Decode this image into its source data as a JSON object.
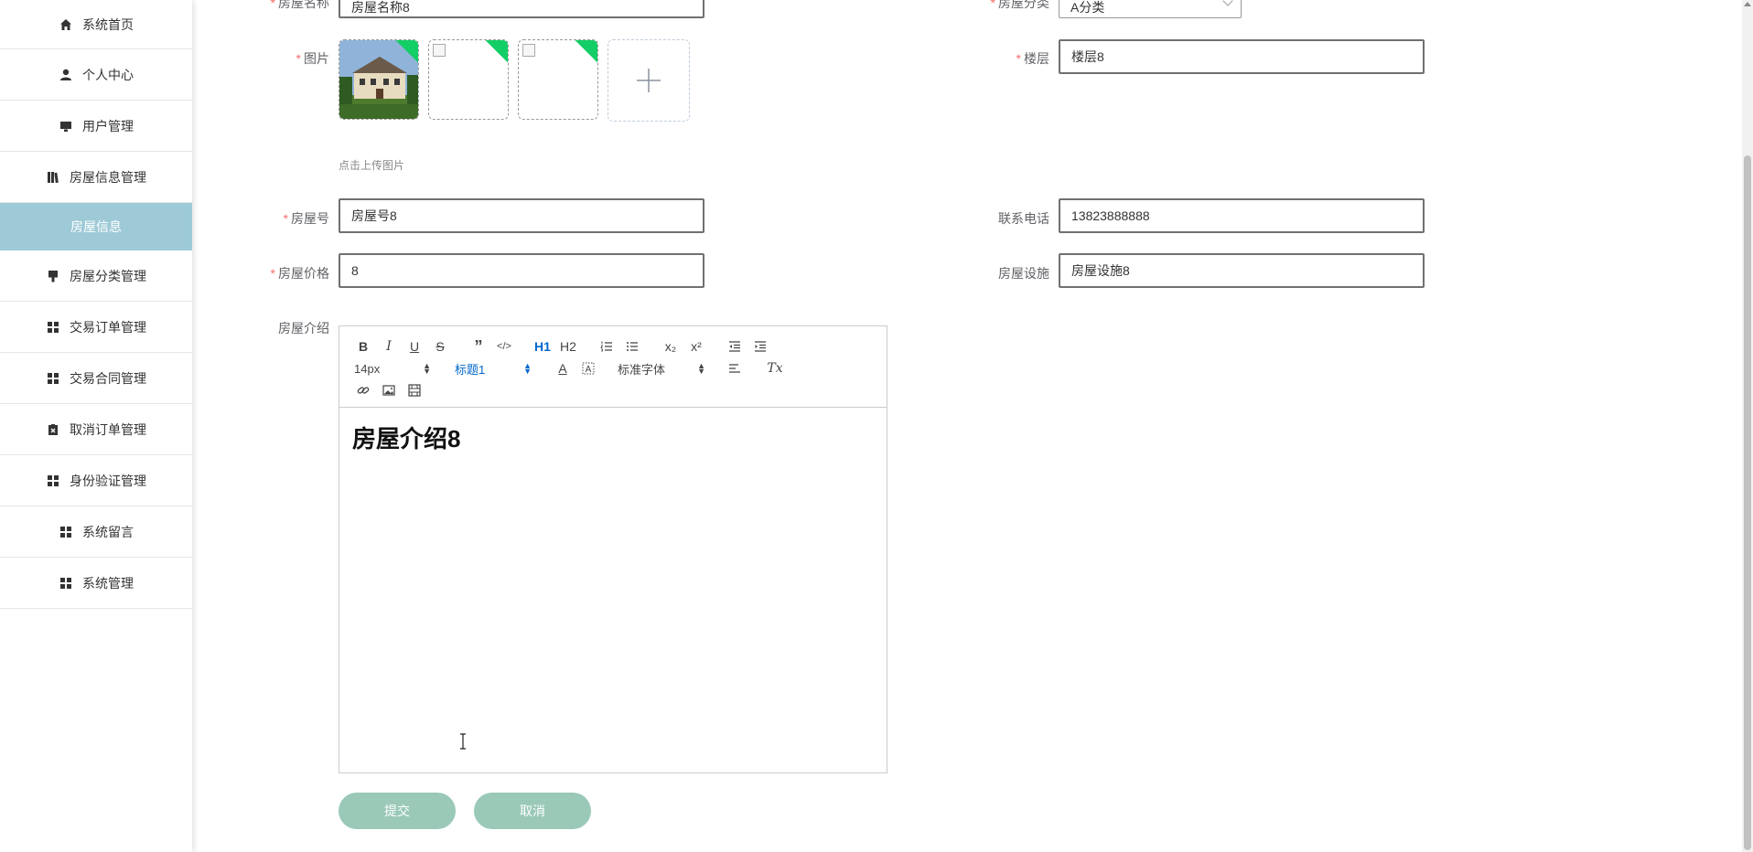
{
  "sidebar": {
    "items": [
      {
        "label": "系统首页",
        "icon": "home-icon"
      },
      {
        "label": "个人中心",
        "icon": "user-icon"
      },
      {
        "label": "用户管理",
        "icon": "monitor-icon"
      },
      {
        "label": "房屋信息管理",
        "icon": "book-icon"
      },
      {
        "label": "房屋信息",
        "icon": ""
      },
      {
        "label": "房屋分类管理",
        "icon": "brush-icon"
      },
      {
        "label": "交易订单管理",
        "icon": "grid-icon"
      },
      {
        "label": "交易合同管理",
        "icon": "grid-icon"
      },
      {
        "label": "取消订单管理",
        "icon": "clipboard-x-icon"
      },
      {
        "label": "身份验证管理",
        "icon": "grid-icon"
      },
      {
        "label": "系统留言",
        "icon": "grid-icon"
      },
      {
        "label": "系统管理",
        "icon": "grid-icon"
      }
    ]
  },
  "form": {
    "house_name": {
      "label": "房屋名称",
      "value": "房屋名称8"
    },
    "category": {
      "label": "房屋分类",
      "value": "A分类"
    },
    "images": {
      "label": "图片",
      "hint": "点击上传图片"
    },
    "floor": {
      "label": "楼层",
      "value": "楼层8"
    },
    "house_no": {
      "label": "房屋号",
      "value": "房屋号8"
    },
    "phone": {
      "label": "联系电话",
      "value": "13823888888"
    },
    "price": {
      "label": "房屋价格",
      "value": "8"
    },
    "facilities": {
      "label": "房屋设施",
      "value": "房屋设施8"
    },
    "intro": {
      "label": "房屋介绍",
      "content": "房屋介绍8"
    },
    "required_mark": "*"
  },
  "editor": {
    "font_size": "14px",
    "header": "标题1",
    "font_family": "标准字体",
    "buttons": {
      "bold": "B",
      "italic": "I",
      "underline": "U",
      "strike": "S",
      "quote": "”",
      "code": "</>",
      "h1": "H1",
      "h2": "H2",
      "sub": "x₂",
      "sup": "x²",
      "text_color": "A",
      "clean": "Tx"
    }
  },
  "actions": {
    "submit": "提交",
    "cancel": "取消"
  },
  "colors": {
    "accent": "#9ecad7",
    "button": "#9ac9b8",
    "required": "#f56c6c",
    "badge": "#13ce66"
  }
}
